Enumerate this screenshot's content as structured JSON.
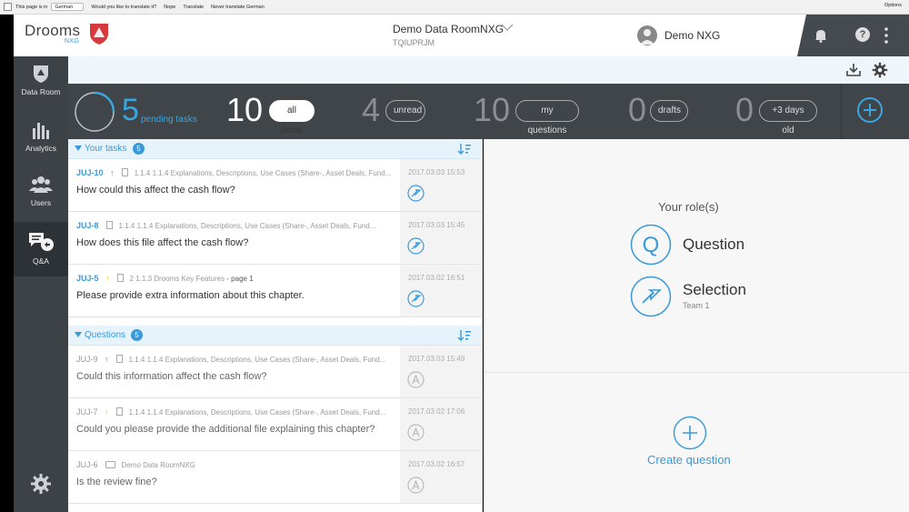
{
  "translate_bar": {
    "lang_label": "This page is in",
    "lang_value": "German",
    "question": "Would you like to translate it?",
    "nope": "Nope",
    "translate": "Translate",
    "never": "Never translate German",
    "options": "Options"
  },
  "header": {
    "logo_text": "Drooms",
    "logo_sub": "NXG",
    "room_title": "Demo Data RoomNXG",
    "room_code": "TQIUPRJM",
    "user_name": "Demo NXG",
    "help_glyph": "?"
  },
  "sidebar": {
    "items": [
      {
        "label": "Data Room",
        "icon": "shield-icon"
      },
      {
        "label": "Analytics",
        "icon": "bar-chart-icon"
      },
      {
        "label": "Users",
        "icon": "users-icon"
      },
      {
        "label": "Q&A",
        "icon": "qa-icon"
      }
    ],
    "active": "Q&A"
  },
  "stats": {
    "pending_count": "5",
    "pending_label": "pending tasks",
    "pending_progress": 0.25,
    "all_count": "10",
    "all_label": "all items",
    "unread_count": "4",
    "unread_label": "unread",
    "myq_count": "10",
    "myq_label": "my questions",
    "drafts_count": "0",
    "drafts_label": "drafts",
    "old_count": "0",
    "old_label": "+3 days old"
  },
  "tasks": {
    "title": "Your tasks",
    "count": "5",
    "rows": [
      {
        "id": "JUJ-10",
        "priority": "up",
        "path": "1.1.4 1.1.4 Explanations, Descriptions, Use Cases (Share-, Asset Deals, Fund...",
        "page": "",
        "text": "How could this affect the cash flow?",
        "date": "2017.03.03 15:53"
      },
      {
        "id": "JUJ-8",
        "priority": "",
        "path": "1.1.4 1.1.4 Explanations, Descriptions, Use Cases (Share-, Asset Deals, Fund...",
        "page": "",
        "text": "How does this file affect the cash flow?",
        "date": "2017.03.03 15:45"
      },
      {
        "id": "JUJ-5",
        "priority": "medium",
        "path": "2 1.1.3 Drooms Key Features",
        "page": " - page 1",
        "text": "Please provide extra information about this chapter.",
        "date": "2017.03.02 16:51"
      }
    ]
  },
  "questions": {
    "title": "Questions",
    "count": "5",
    "rows": [
      {
        "id": "JUJ-9",
        "priority": "up",
        "path": "1.1.4 1.1.4 Explanations, Descriptions, Use Cases (Share-, Asset Deals, Fund...",
        "text": "Could this information affect the cash flow?",
        "date": "2017.03.03 15:49"
      },
      {
        "id": "JUJ-7",
        "priority": "medium",
        "path": "1.1.4 1.1.4 Explanations, Descriptions, Use Cases (Share-, Asset Deals, Fund...",
        "text": "Could you please provide the additional file explaining this chapter?",
        "date": "2017.03.02 17:06"
      },
      {
        "id": "JUJ-6",
        "priority": "",
        "path": "Demo Data RoomNXG",
        "text": "Is the review fine?",
        "date": "2017.03.02 16:57"
      }
    ]
  },
  "roles": {
    "title": "Your role(s)",
    "question_label": "Question",
    "question_glyph": "Q",
    "selection_label": "Selection",
    "selection_sub": "Team 1"
  },
  "create": {
    "label": "Create question"
  },
  "colors": {
    "accent": "#3a9ad9",
    "priority_high": "#e8613a",
    "priority_medium": "#f0c419",
    "sidebar": "#3d4247",
    "stats_bar": "#404549"
  }
}
